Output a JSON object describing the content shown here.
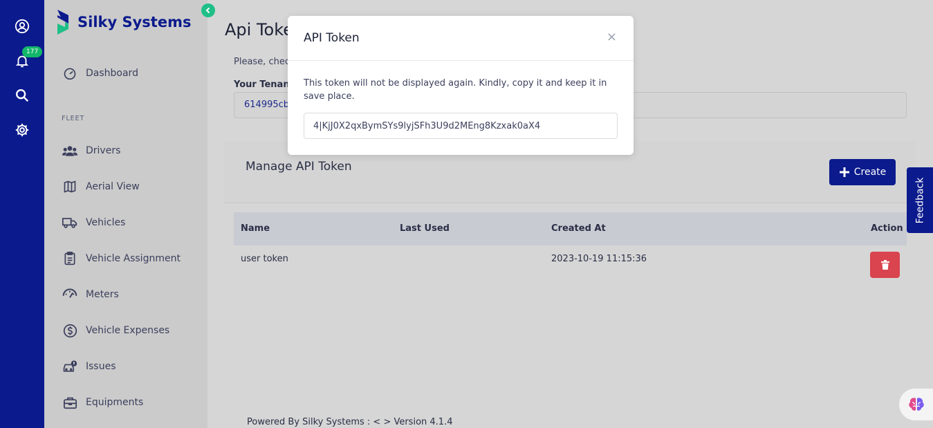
{
  "rail": {
    "notification_count": "177"
  },
  "brand": {
    "name": "Silky Systems"
  },
  "sidebar": {
    "dashboard": "Dashboard",
    "section_fleet": "FLEET",
    "items": [
      "Drivers",
      "Aerial View",
      "Vehicles",
      "Vehicle Assignment",
      "Meters",
      "Vehicle Expenses",
      "Issues",
      "Equipments"
    ]
  },
  "main": {
    "title": "Api Token",
    "description": "Please, check",
    "tenant_label": "Your Tenant",
    "tenant_value": "614995cb-",
    "card_title": "Manage API Token",
    "create_label": "Create",
    "table": {
      "headers": [
        "Name",
        "Last Used",
        "Created At",
        "Action"
      ],
      "rows": [
        {
          "name": "user token",
          "last_used": "",
          "created_at": "2023-10-19 11:15:36"
        }
      ]
    },
    "footer": "Powered By Silky Systems : < > Version 4.1.4"
  },
  "feedback_label": "Feedback",
  "modal": {
    "title": "API Token",
    "close": "×",
    "message": "This token will not be displayed again. Kindly, copy it and keep it in save place.",
    "token": "4|KjJ0X2qxBymSYs9lyjSFh3U9d2MEng8Kzxak0aX4"
  },
  "colors": {
    "primary": "#0b1a8c",
    "accent": "#1fbf87",
    "danger": "#d9444e",
    "badge": "#12b76a"
  }
}
